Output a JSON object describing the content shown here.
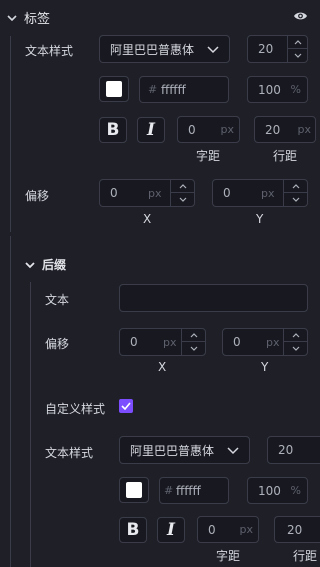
{
  "label_section": {
    "title": "标签",
    "text_style_label": "文本样式",
    "font_select": "阿里巴巴普惠体",
    "font_size": "20",
    "color_hash": "#",
    "color_value": "ffffff",
    "opacity_value": "100",
    "opacity_unit": "%",
    "bold_glyph": "B",
    "italic_glyph": "I",
    "letter_spacing_value": "0",
    "letter_spacing_unit": "px",
    "line_height_value": "20",
    "line_height_unit": "px",
    "letter_spacing_caption": "字距",
    "line_height_caption": "行距",
    "offset_label": "偏移",
    "offset_x_value": "0",
    "offset_x_unit": "px",
    "offset_y_value": "0",
    "offset_y_unit": "px",
    "x_caption": "X",
    "y_caption": "Y"
  },
  "suffix_section": {
    "title": "后缀",
    "text_label": "文本",
    "text_value": "",
    "offset_label": "偏移",
    "offset_x_value": "0",
    "offset_x_unit": "px",
    "offset_y_value": "0",
    "offset_y_unit": "px",
    "x_caption": "X",
    "y_caption": "Y",
    "custom_style_label": "自定义样式",
    "custom_style_checked": true,
    "text_style_label": "文本样式",
    "font_select": "阿里巴巴普惠体",
    "font_size": "20",
    "color_hash": "#",
    "color_value": "ffffff",
    "opacity_value": "100",
    "opacity_unit": "%",
    "bold_glyph": "B",
    "italic_glyph": "I",
    "letter_spacing_value": "0",
    "letter_spacing_unit": "px",
    "line_height_value": "20",
    "letter_spacing_caption": "字距",
    "line_height_caption": "行距"
  },
  "colors": {
    "accent": "#7b4dff",
    "background": "#1e1f27",
    "field": "#181920",
    "border": "#3a3d49"
  },
  "icons": {
    "collapse": "chevron-down-icon",
    "visibility": "eye-icon",
    "step_up": "chevron-up-icon",
    "step_down": "chevron-down-icon",
    "check": "check-icon"
  }
}
